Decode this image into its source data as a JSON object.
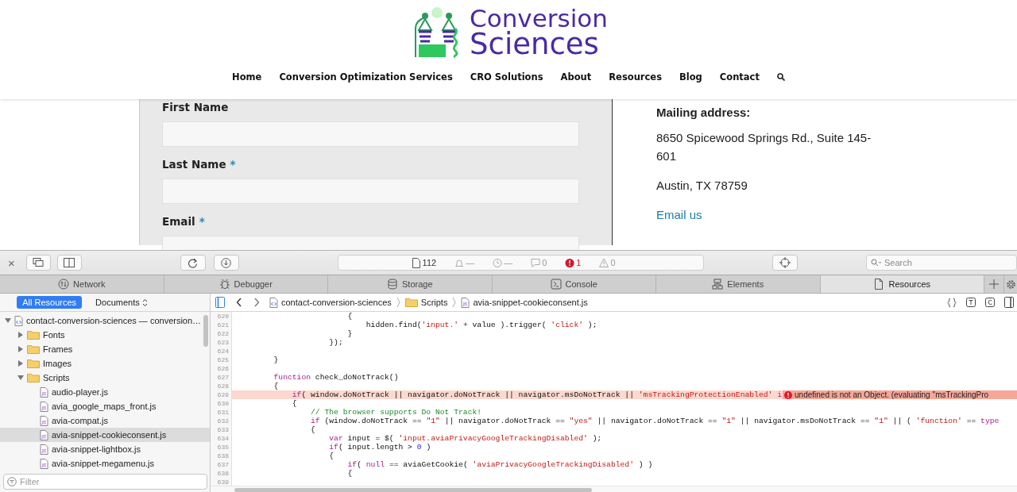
{
  "site": {
    "logo": {
      "line_1": "Conversion",
      "line_2": "Sciences"
    },
    "nav": [
      {
        "label": "Home"
      },
      {
        "label": "Conversion Optimization Services"
      },
      {
        "label": "CRO Solutions"
      },
      {
        "label": "About"
      },
      {
        "label": "Resources"
      },
      {
        "label": "Blog"
      },
      {
        "label": "Contact"
      }
    ],
    "form": {
      "fields": [
        {
          "label": "First Name"
        },
        {
          "label": "Last Name",
          "required_mark": "*"
        },
        {
          "label": "Email",
          "required_mark": "*"
        }
      ]
    },
    "address": {
      "heading": "Mailing address:",
      "lines": [
        "8650 Spicewood Springs Rd., Suite 145-601",
        "Austin, TX 78759"
      ],
      "link": "Email us"
    }
  },
  "devtools": {
    "toolbar": {
      "close": "×",
      "status": [
        {
          "kind": "resources",
          "text": "112"
        },
        {
          "kind": "logs",
          "text": "—"
        },
        {
          "kind": "timer",
          "text": "—"
        },
        {
          "kind": "messages",
          "text": "0"
        },
        {
          "kind": "errors",
          "text": "1"
        },
        {
          "kind": "warnings",
          "text": "0"
        }
      ],
      "search": {
        "placeholder": "Search"
      }
    },
    "tabs": [
      {
        "kind": "network",
        "label": "Network",
        "selected": false
      },
      {
        "kind": "debugger",
        "label": "Debugger",
        "selected": false
      },
      {
        "kind": "storage",
        "label": "Storage",
        "selected": false
      },
      {
        "kind": "console",
        "label": "Console",
        "selected": false
      },
      {
        "kind": "elements",
        "label": "Elements",
        "selected": false
      },
      {
        "kind": "resources",
        "label": "Resources",
        "selected": true
      }
    ],
    "sidebar": {
      "scopes": [
        {
          "label": "All Resources",
          "selected": true
        },
        {
          "label": "Documents",
          "selected": false
        }
      ],
      "tree": [
        {
          "kind": "page",
          "label": "contact-conversion-sciences — conversion…",
          "selected": false,
          "expanded": true,
          "children": [
            {
              "kind": "folder",
              "label": "Fonts",
              "selected": false,
              "expanded": false
            },
            {
              "kind": "folder",
              "label": "Frames",
              "selected": false,
              "expanded": false
            },
            {
              "kind": "folder",
              "label": "Images",
              "selected": false,
              "expanded": false
            },
            {
              "kind": "folder",
              "label": "Scripts",
              "selected": false,
              "expanded": true,
              "children": [
                {
                  "kind": "script",
                  "label": "audio-player.js",
                  "selected": false
                },
                {
                  "kind": "script",
                  "label": "avia_google_maps_front.js",
                  "selected": false
                },
                {
                  "kind": "script",
                  "label": "avia-compat.js",
                  "selected": false
                },
                {
                  "kind": "script",
                  "label": "avia-snippet-cookieconsent.js",
                  "selected": true
                },
                {
                  "kind": "script",
                  "label": "avia-snippet-lightbox.js",
                  "selected": false
                },
                {
                  "kind": "script",
                  "label": "avia-snippet-megamenu.js",
                  "selected": false
                }
              ]
            }
          ]
        }
      ],
      "filter": {
        "placeholder": "Filter"
      }
    },
    "editor": {
      "breadcrumb": [
        {
          "kind": "page",
          "label": "contact-conversion-sciences"
        },
        {
          "kind": "folder",
          "label": "Scripts"
        },
        {
          "kind": "script",
          "label": "avia-snippet-cookieconsent.js"
        }
      ],
      "lines": [
        {
          "number": "620",
          "tokens": [
            {
              "kind": "plain",
              "text": "                        {"
            }
          ]
        },
        {
          "number": "621",
          "tokens": [
            {
              "kind": "plain",
              "text": "                            hidden.find("
            },
            {
              "kind": "string",
              "text": "'input.'"
            },
            {
              "kind": "plain",
              "text": " + value ).trigger( "
            },
            {
              "kind": "string",
              "text": "'click'"
            },
            {
              "kind": "plain",
              "text": " );"
            }
          ]
        },
        {
          "number": "622",
          "tokens": [
            {
              "kind": "plain",
              "text": "                        }"
            }
          ]
        },
        {
          "number": "623",
          "tokens": [
            {
              "kind": "plain",
              "text": "                    });"
            }
          ]
        },
        {
          "number": "624"
        },
        {
          "number": "625",
          "tokens": [
            {
              "kind": "plain",
              "text": "        }"
            }
          ]
        },
        {
          "number": "626"
        },
        {
          "number": "627",
          "tokens": [
            {
              "kind": "keyword",
              "text": "        function"
            },
            {
              "kind": "plain",
              "text": " check_doNotTrack()"
            }
          ]
        },
        {
          "number": "628",
          "tokens": [
            {
              "kind": "plain",
              "text": "        {"
            }
          ]
        },
        {
          "number": "629",
          "tokens": [
            {
              "kind": "keyword",
              "text": "            if"
            },
            {
              "kind": "plain",
              "text": "( window.doNotTrack || navigator.doNotTrack || navigator.msDoNotTrack || "
            },
            {
              "kind": "string",
              "text": "'msTrackingProtectionEnabled'"
            },
            {
              "kind": "keyword",
              "text": " i"
            }
          ],
          "error": "undefined is not an Object. (evaluating ''msTrackingPro"
        },
        {
          "number": "630",
          "tokens": [
            {
              "kind": "plain",
              "text": "            {"
            }
          ]
        },
        {
          "number": "631",
          "tokens": [
            {
              "kind": "comment",
              "text": "                // The browser supports Do Not Track!"
            }
          ]
        },
        {
          "number": "632",
          "tokens": [
            {
              "kind": "keyword",
              "text": "                if"
            },
            {
              "kind": "plain",
              "text": " (window.doNotTrack == "
            },
            {
              "kind": "string",
              "text": "\"1\""
            },
            {
              "kind": "plain",
              "text": " || navigator.doNotTrack == "
            },
            {
              "kind": "string",
              "text": "\"yes\""
            },
            {
              "kind": "plain",
              "text": " || navigator.doNotTrack == "
            },
            {
              "kind": "string",
              "text": "\"1\""
            },
            {
              "kind": "plain",
              "text": " || navigator.msDoNotTrack == "
            },
            {
              "kind": "string",
              "text": "\"1\""
            },
            {
              "kind": "plain",
              "text": " || ( "
            },
            {
              "kind": "string",
              "text": "'function'"
            },
            {
              "kind": "plain",
              "text": " == "
            },
            {
              "kind": "keyword",
              "text": "type"
            }
          ]
        },
        {
          "number": "633",
          "tokens": [
            {
              "kind": "plain",
              "text": "                {"
            }
          ]
        },
        {
          "number": "634",
          "tokens": [
            {
              "kind": "keyword",
              "text": "                    var"
            },
            {
              "kind": "plain",
              "text": " input = $( "
            },
            {
              "kind": "string",
              "text": "'input.aviaPrivacyGoogleTrackingDisabled'"
            },
            {
              "kind": "plain",
              "text": " );"
            }
          ]
        },
        {
          "number": "635",
          "tokens": [
            {
              "kind": "keyword",
              "text": "                    if"
            },
            {
              "kind": "plain",
              "text": "( input.length > "
            },
            {
              "kind": "number",
              "text": "0"
            },
            {
              "kind": "plain",
              "text": " )"
            }
          ]
        },
        {
          "number": "636",
          "tokens": [
            {
              "kind": "plain",
              "text": "                    {"
            }
          ]
        },
        {
          "number": "637",
          "tokens": [
            {
              "kind": "keyword",
              "text": "                        if"
            },
            {
              "kind": "plain",
              "text": "( "
            },
            {
              "kind": "keyword",
              "text": "null"
            },
            {
              "kind": "plain",
              "text": " == aviaGetCookie( "
            },
            {
              "kind": "string",
              "text": "'aviaPrivacyGoogleTrackingDisabled'"
            },
            {
              "kind": "plain",
              "text": " ) )"
            }
          ]
        },
        {
          "number": "638",
          "tokens": [
            {
              "kind": "plain",
              "text": "                        {"
            }
          ]
        },
        {
          "number": "639"
        }
      ]
    }
  }
}
